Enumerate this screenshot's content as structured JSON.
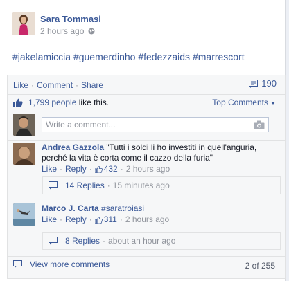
{
  "post": {
    "author": "Sara Tommasi",
    "time": "2 hours ago",
    "hashtags": [
      "#jakelamiccia",
      "#guemerdinho",
      "#fedezzaids",
      "#marrescort"
    ]
  },
  "actions": {
    "like": "Like",
    "comment": "Comment",
    "share": "Share",
    "comment_count": "190"
  },
  "likes": {
    "count": "1,799 people",
    "suffix": "like this.",
    "top_comments": "Top Comments"
  },
  "composer": {
    "placeholder": "Write a comment..."
  },
  "comments": [
    {
      "author": "Andrea Gazzola",
      "text": "\"Tutti i soldi li ho investiti in quell'anguria, perché la vita è corta come il cazzo della furia\"",
      "like": "Like",
      "reply": "Reply",
      "likes": "432",
      "time": "2 hours ago",
      "replies": "14 Replies",
      "replies_time": "15 minutes ago"
    },
    {
      "author": "Marco J. Carta",
      "text": "#saratroiasi",
      "like": "Like",
      "reply": "Reply",
      "likes": "311",
      "time": "2 hours ago",
      "replies": "8 Replies",
      "replies_time": "about an hour ago"
    }
  ],
  "footer": {
    "view_more": "View more comments",
    "pager": "2 of 255"
  },
  "colors": {
    "link": "#3b5998",
    "muted": "#90949c",
    "panel": "#f6f7f8"
  }
}
